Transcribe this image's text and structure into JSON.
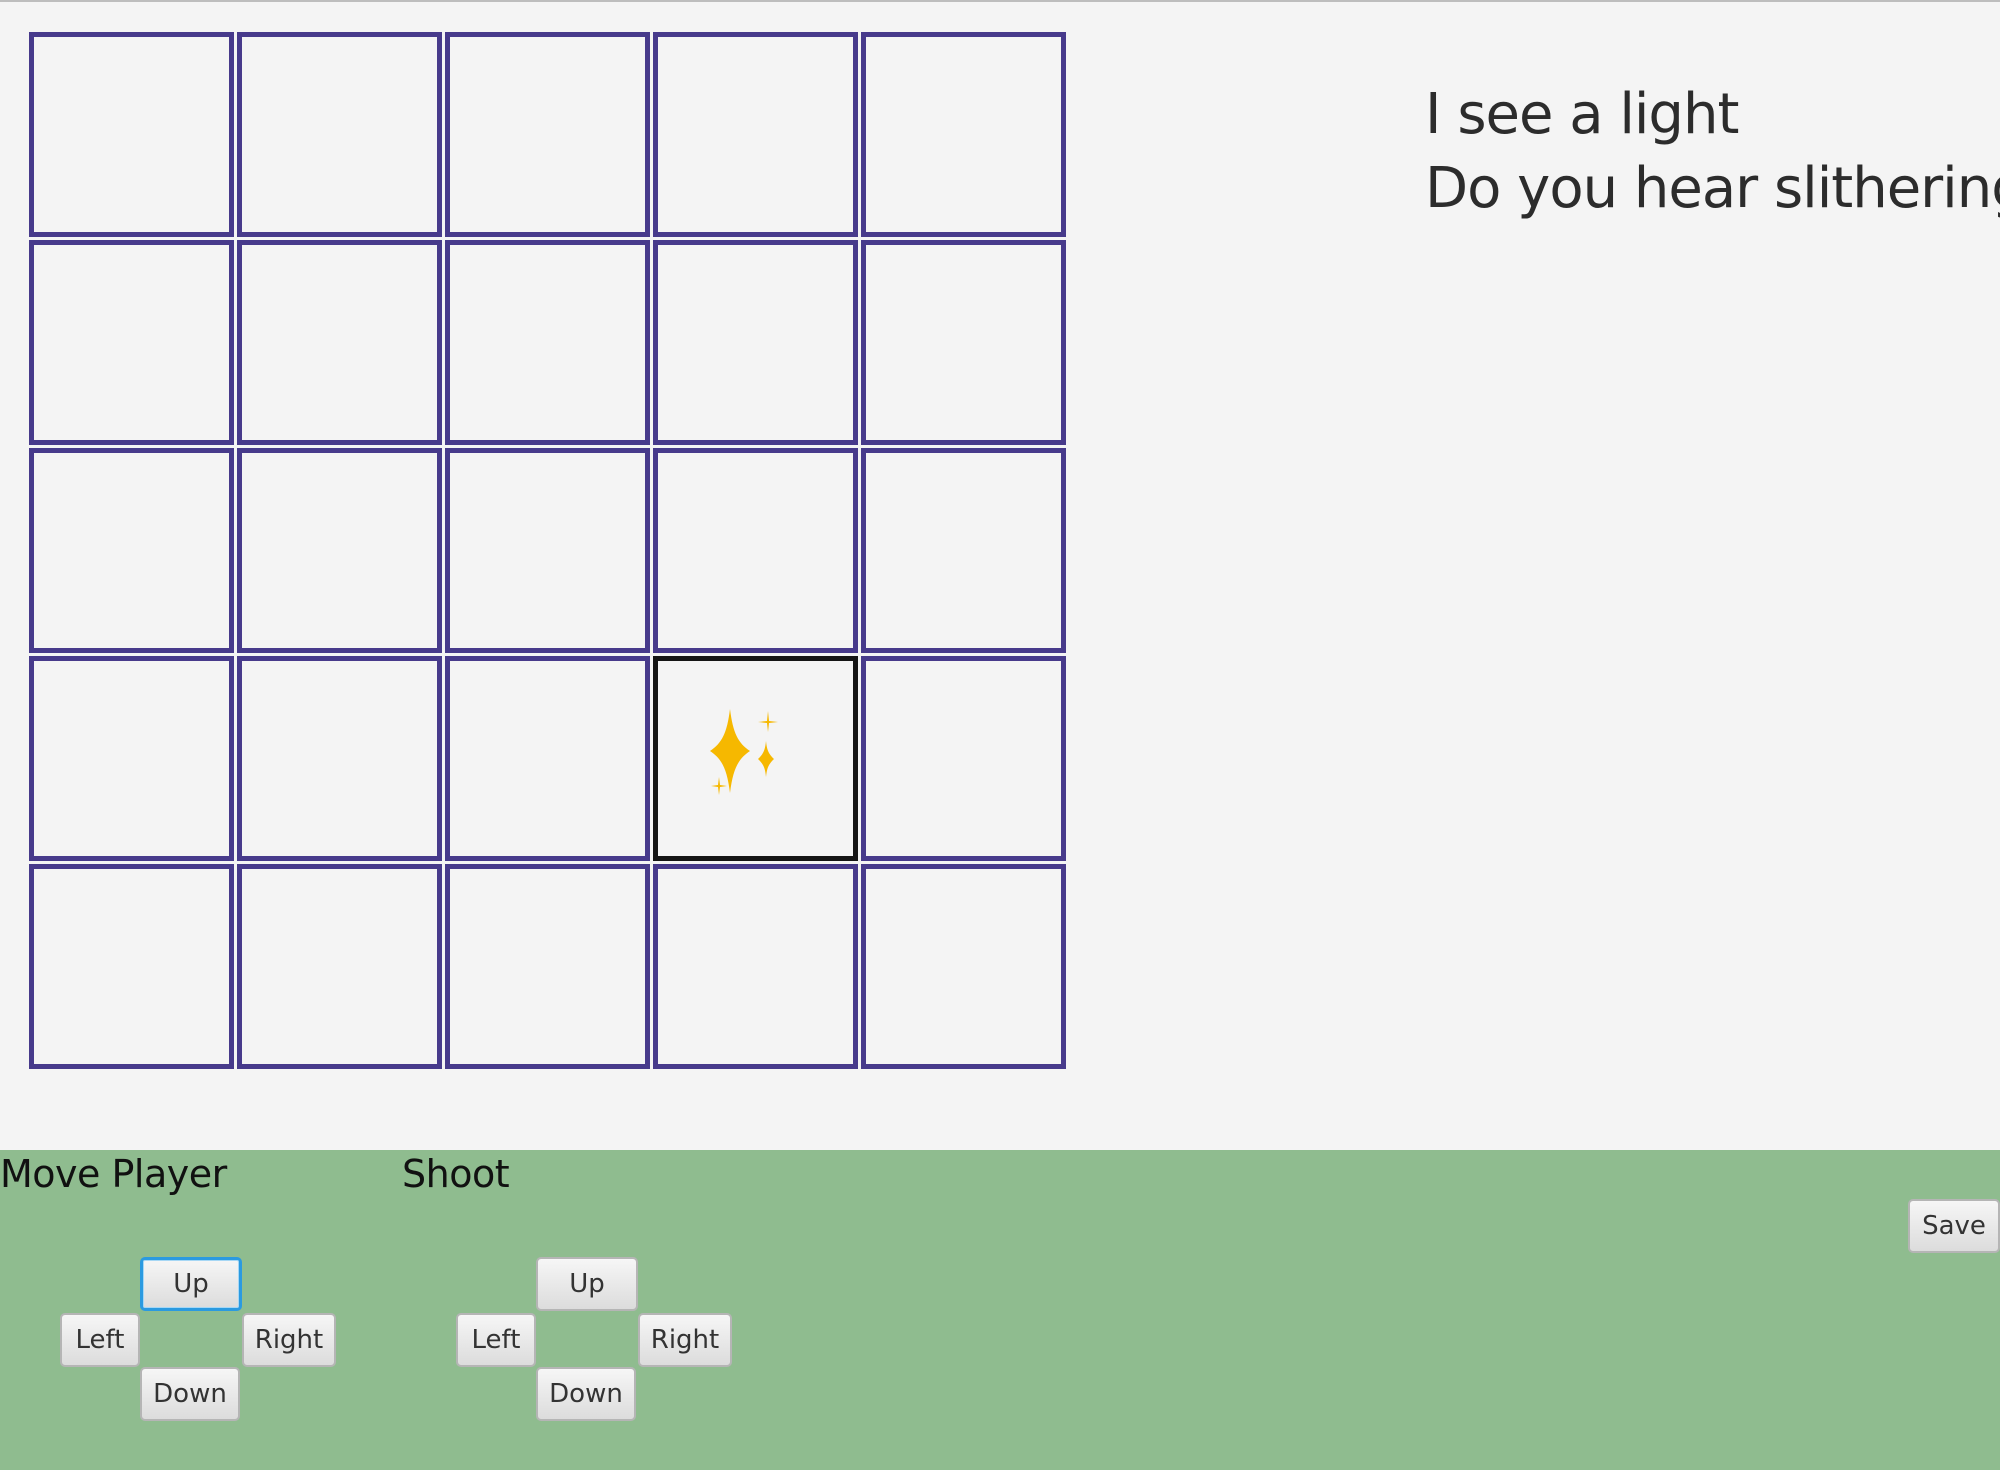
{
  "messages": {
    "line1": "I see a light",
    "line2": "Do you hear slithering?"
  },
  "board": {
    "rows": 5,
    "cols": 5,
    "current_cell": {
      "row": 4,
      "col": 4
    },
    "current_cell_icon": "sparkle-icon",
    "cell_border_color": "#473a8b",
    "current_cell_border_color": "#151515",
    "sparkle_color": "#f6b800"
  },
  "controls": {
    "background_color": "#8fbc8f",
    "move": {
      "title": "Move Player",
      "up": "Up",
      "left": "Left",
      "right": "Right",
      "down": "Down"
    },
    "shoot": {
      "title": "Shoot",
      "up": "Up",
      "left": "Left",
      "right": "Right",
      "down": "Down"
    },
    "save": "Save"
  }
}
